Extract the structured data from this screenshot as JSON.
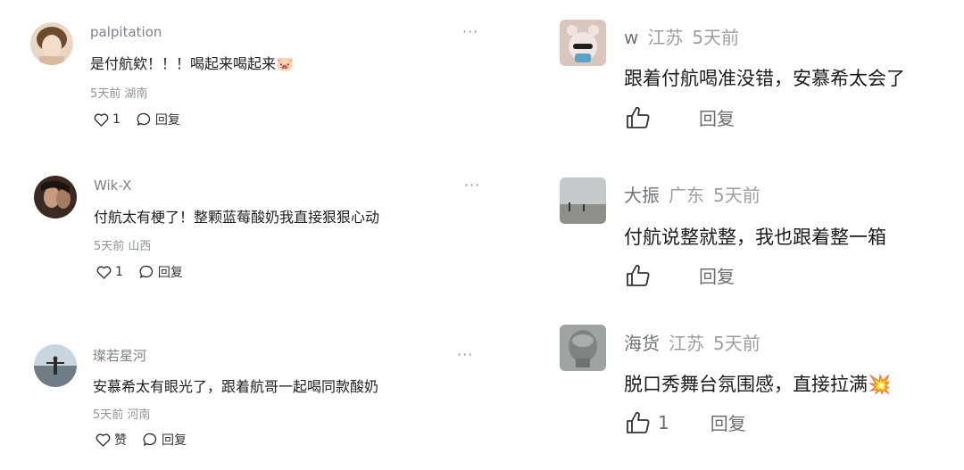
{
  "left_comments": [
    {
      "username": "palpitation",
      "text": "是付航欸！！！喝起来喝起来🐷",
      "time": "5天前",
      "location": "湖南",
      "likes": "1",
      "reply_label": "回复",
      "more_label": "···"
    },
    {
      "username": "Wik-X",
      "text": "付航太有梗了！整颗蓝莓酸奶我直接狠狠心动",
      "time": "5天前",
      "location": "山西",
      "likes": "1",
      "reply_label": "回复",
      "more_label": "···"
    },
    {
      "username": "璨若星河",
      "text": "安慕希太有眼光了，跟着航哥一起喝同款酸奶",
      "time": "5天前",
      "location": "河南",
      "likes": "赞",
      "reply_label": "回复",
      "more_label": "···"
    }
  ],
  "right_comments": [
    {
      "username": "w",
      "location": "江苏",
      "time": "5天前",
      "text": "跟着付航喝准没错，安慕希太会了",
      "likes": "",
      "reply_label": "回复"
    },
    {
      "username": "大振",
      "location": "广东",
      "time": "5天前",
      "text": "付航说整就整，我也跟着整一箱",
      "likes": "",
      "reply_label": "回复"
    },
    {
      "username": "海货",
      "location": "江苏",
      "time": "5天前",
      "text": "脱口秀舞台氛围感，直接拉满💥",
      "likes": "1",
      "reply_label": "回复"
    }
  ],
  "colors": {
    "text": "#1e1e1e",
    "meta": "#8f949b",
    "username": "#7d8289"
  }
}
